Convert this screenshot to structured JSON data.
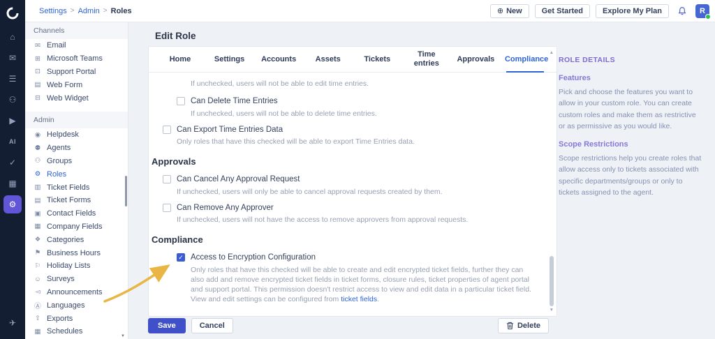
{
  "colors": {
    "accent_blue": "#2e63d6",
    "save_button": "#4050c8",
    "rail_background": "#141e33",
    "active_rail_purple": "#6156d8",
    "annotation_yellow": "#e9b544",
    "checked_checkbox": "#3b5cd7"
  },
  "icons": {
    "check": "✓",
    "plus_circle": "⊕",
    "scroll_up": "▲",
    "scroll_down": "▼"
  },
  "rail": {
    "glyphs": {
      "home": "⌂",
      "tickets": "✉",
      "contacts": "☰",
      "customers": "⚇",
      "solutions": "▶",
      "ai": "AI",
      "tasks": "✓",
      "reports": "▦",
      "admin": "⚙",
      "ship": "✈"
    }
  },
  "topbar": {
    "breadcrumb": {
      "items": [
        "Settings",
        "Admin",
        "Roles"
      ],
      "sep": ">"
    },
    "new_label": "New",
    "get_started_label": "Get Started",
    "explore_label": "Explore My Plan",
    "avatar_initial": "R"
  },
  "sidebar": {
    "sections": [
      {
        "title": "Channels",
        "items": [
          {
            "icon": "✉",
            "label": "Email"
          },
          {
            "icon": "⊞",
            "label": "Microsoft Teams"
          },
          {
            "icon": "⊡",
            "label": "Support Portal"
          },
          {
            "icon": "▤",
            "label": "Web Form"
          },
          {
            "icon": "⊟",
            "label": "Web Widget"
          }
        ]
      },
      {
        "title": "Admin",
        "items": [
          {
            "icon": "◉",
            "label": "Helpdesk"
          },
          {
            "icon": "⚉",
            "label": "Agents"
          },
          {
            "icon": "⚇",
            "label": "Groups"
          },
          {
            "icon": "⚙",
            "label": "Roles"
          },
          {
            "icon": "▥",
            "label": "Ticket Fields"
          },
          {
            "icon": "▤",
            "label": "Ticket Forms"
          },
          {
            "icon": "▣",
            "label": "Contact Fields"
          },
          {
            "icon": "▦",
            "label": "Company Fields"
          },
          {
            "icon": "❖",
            "label": "Categories"
          },
          {
            "icon": "⚑",
            "label": "Business Hours"
          },
          {
            "icon": "⚐",
            "label": "Holiday Lists"
          },
          {
            "icon": "☺",
            "label": "Surveys"
          },
          {
            "icon": "◅",
            "label": "Announcements"
          },
          {
            "icon": "Ⓐ",
            "label": "Languages"
          },
          {
            "icon": "⇧",
            "label": "Exports"
          },
          {
            "icon": "▦",
            "label": "Schedules"
          }
        ]
      }
    ]
  },
  "main": {
    "title": "Edit Role",
    "tabs": [
      "Home",
      "Settings",
      "Accounts",
      "Assets",
      "Tickets",
      "Time entries",
      "Approvals",
      "Compliance"
    ],
    "active_tab": "Compliance",
    "rows": [
      {
        "type": "hint",
        "hint": "If unchecked, users will not be able to edit time entries."
      },
      {
        "type": "checkbox",
        "checked": false,
        "label": "Can Delete Time Entries",
        "hint": "If unchecked, users will not be able to delete time entries."
      },
      {
        "type": "checkbox",
        "checked": false,
        "label": "Can Export Time Entries Data",
        "hint": "Only roles that have this checked will be able to export Time Entries data."
      },
      {
        "type": "section",
        "label": "Approvals"
      },
      {
        "type": "checkbox",
        "checked": false,
        "label": "Can Cancel Any Approval Request",
        "hint": "If unchecked, users will only be able to cancel approval requests created by them."
      },
      {
        "type": "checkbox",
        "checked": false,
        "label": "Can Remove Any Approver",
        "hint": "If unchecked, users will not have the access to remove approvers from approval requests."
      },
      {
        "type": "section",
        "label": "Compliance"
      },
      {
        "type": "checkbox",
        "checked": true,
        "label": "Access to Encryption Configuration",
        "hint": "Only roles that have this checked will be able to create and edit encrypted ticket fields, further they can also add and remove encrypted ticket fields in ticket forms, closure rules, ticket properties of agent portal and support portal. This permission doesn't restrict access to view and edit data in a particular ticket field. View and edit settings can be configured from ",
        "link": "ticket fields",
        "after": "."
      }
    ]
  },
  "footer": {
    "save": "Save",
    "cancel": "Cancel",
    "delete": "Delete"
  },
  "details": {
    "title": "ROLE DETAILS",
    "features_heading": "Features",
    "features_body": "Pick and choose the features you want to allow in your custom role. You can create custom roles and make them as restrictive or as permissive as you would like.",
    "scope_heading": "Scope Restrictions",
    "scope_body": "Scope restrictions help you create roles that allow access only to tickets associated with specific departments/groups or only to tickets assigned to the agent."
  }
}
